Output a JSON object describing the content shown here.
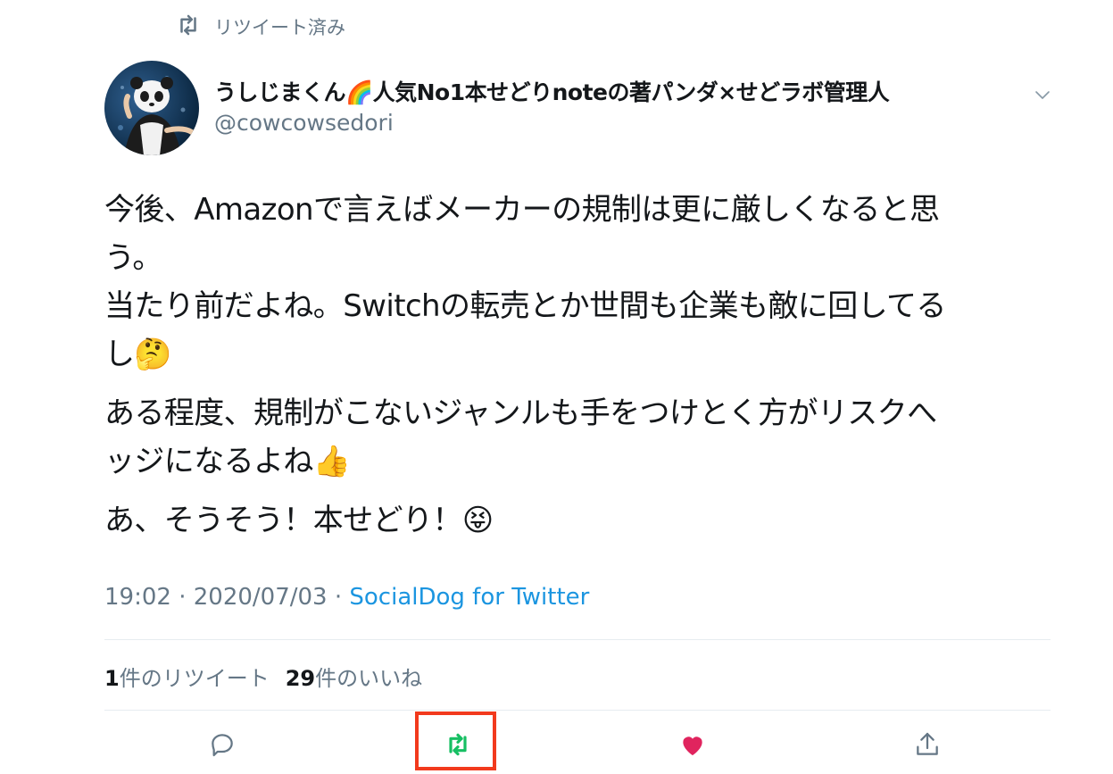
{
  "retweet_header": {
    "label": "リツイート済み",
    "icon": "retweet-icon"
  },
  "author": {
    "display_name": "うしじまくん🌈人気No1本せどりnoteの著パンダ×せどラボ管理人",
    "handle": "@cowcowsedori",
    "avatar": "panda-avatar"
  },
  "tweet": {
    "paragraphs": [
      {
        "lines": [
          "今後、Amazonで言えばメーカーの規制は更に厳しくなると思",
          "う。",
          "当たり前だよね。Switchの転売とか世間も企業も敵に回してる",
          "し🤔"
        ]
      },
      {
        "lines": [
          "ある程度、規制がこないジャンルも手をつけとく方がリスクへ",
          "ッジになるよね👍"
        ]
      },
      {
        "lines": [
          "あ、そうそう！本せどり！😝"
        ]
      }
    ]
  },
  "meta": {
    "time": "19:02",
    "separator": "·",
    "date": "2020/07/03",
    "source": "SocialDog for Twitter"
  },
  "stats": {
    "retweet_count": "1",
    "retweet_label": "件のリツイート",
    "like_count": "29",
    "like_label": "件のいいね"
  },
  "actions": [
    {
      "name": "reply",
      "icon": "reply-icon",
      "color": "#657786"
    },
    {
      "name": "retweet",
      "icon": "retweet-icon",
      "color": "#17bf63",
      "active": true
    },
    {
      "name": "like",
      "icon": "heart-icon",
      "color": "#e0245e",
      "active": true
    },
    {
      "name": "share",
      "icon": "share-icon",
      "color": "#657786"
    }
  ],
  "colors": {
    "highlight": "#f23a1d",
    "link": "#1b95e0",
    "secondary": "#657786"
  }
}
